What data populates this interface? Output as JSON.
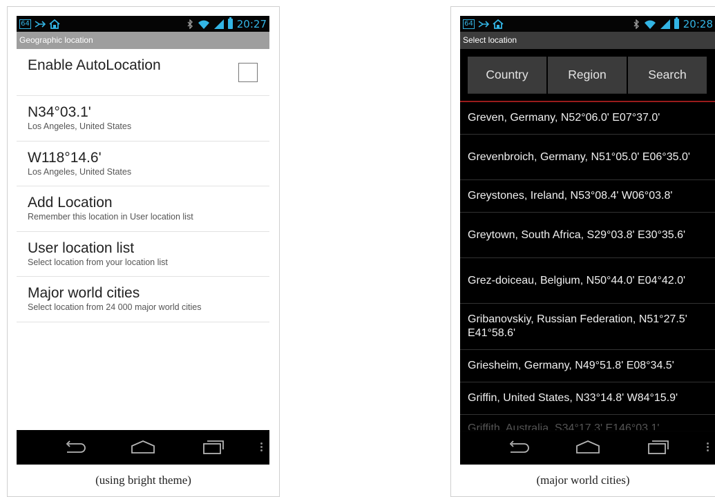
{
  "left": {
    "status": {
      "badge": "64",
      "time": "20:27"
    },
    "title": "Geographic location",
    "items": [
      {
        "title": "Enable AutoLocation",
        "subtitle": ""
      },
      {
        "title": "N34°03.1'",
        "subtitle": "Los Angeles, United States"
      },
      {
        "title": "W118°14.6'",
        "subtitle": "Los Angeles, United States"
      },
      {
        "title": "Add Location",
        "subtitle": "Remember this location in User location list"
      },
      {
        "title": "User location list",
        "subtitle": "Select location from your location list"
      },
      {
        "title": "Major world cities",
        "subtitle": "Select location from 24 000 major world cities"
      }
    ],
    "autolocation_checked": false,
    "caption": "(using bright theme)"
  },
  "right": {
    "status": {
      "badge": "64",
      "time": "20:28"
    },
    "title": "Select location",
    "tabs": [
      "Country",
      "Region",
      "Search"
    ],
    "cities": [
      "Greven, Germany, N52°06.0' E07°37.0'",
      "Grevenbroich, Germany, N51°05.0' E06°35.0'",
      "Greystones, Ireland, N53°08.4' W06°03.8'",
      "Greytown, South Africa, S29°03.8' E30°35.6'",
      "Grez-doiceau, Belgium, N50°44.0' E04°42.0'",
      "Gribanovskiy, Russian Federation, N51°27.5' E41°58.6'",
      "Griesheim, Germany, N49°51.8' E08°34.5'",
      "Griffin, United States, N33°14.8' W84°15.9'",
      "Griffith, Australia, S34°17.3' E146°03.1'"
    ],
    "caption": "(major world cities)"
  },
  "icons": {
    "notification": "notification-icon",
    "home_app": "launcher-icon",
    "bluetooth": "bluetooth-icon",
    "wifi": "wifi-icon",
    "signal": "signal-icon",
    "battery": "battery-icon",
    "back": "back-icon",
    "home": "home-icon",
    "recents": "recents-icon",
    "menu": "overflow-menu-icon"
  },
  "colors": {
    "status_accent": "#33b5e5",
    "title_bar_light": "#9e9e9e",
    "title_bar_dark": "#3c3c3c",
    "tab_divider": "#9a1b1b"
  }
}
